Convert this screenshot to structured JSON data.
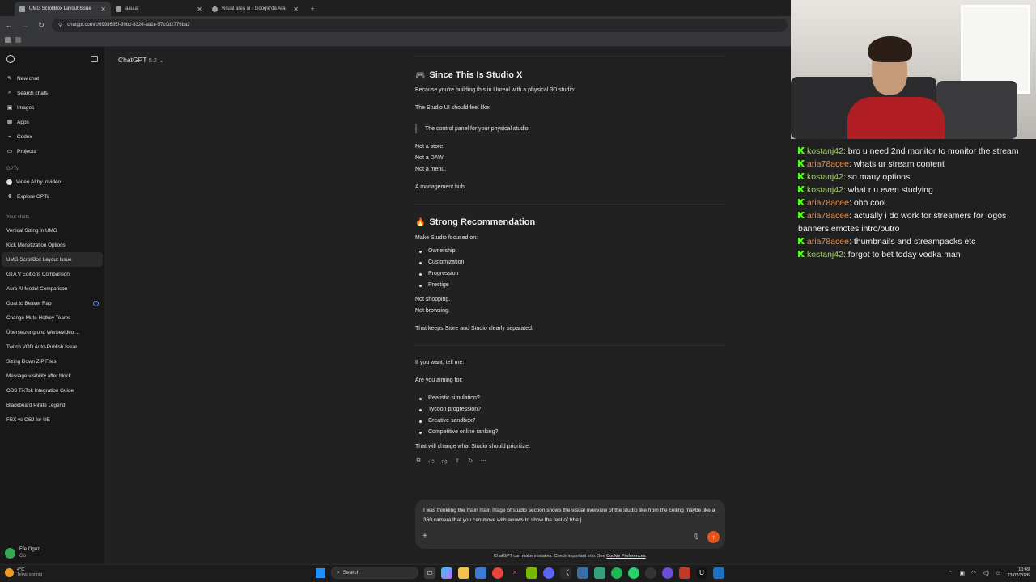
{
  "browser": {
    "tabs": [
      {
        "label": "UMG ScrollBox Layout Issue",
        "active": true
      },
      {
        "label": "aau.at",
        "active": false
      },
      {
        "label": "visual area ui - Google'da Ara",
        "active": false
      }
    ],
    "new_tab": "+",
    "close": "✕",
    "url": "chatgpt.com/c/6993685f-99bc-8326-aa1e-57c0d2776ba2"
  },
  "sidebar": {
    "items": [
      {
        "label": "New chat",
        "icon": "compose-icon"
      },
      {
        "label": "Search chats",
        "icon": "search-icon"
      },
      {
        "label": "Images",
        "icon": "image-icon"
      },
      {
        "label": "Apps",
        "icon": "apps-icon"
      },
      {
        "label": "Codex",
        "icon": "code-icon"
      },
      {
        "label": "Projects",
        "icon": "folder-icon"
      }
    ],
    "gpts_label": "GPTs",
    "gpts": [
      {
        "label": "Video AI by invideo"
      },
      {
        "label": "Explore GPTs"
      }
    ],
    "chats_label": "Your chats",
    "chats": [
      "Vertical Sizing in UMG",
      "Kick Monetization Options",
      "UMG ScrollBox Layout Issue",
      "GTA V Editions Comparison",
      "Aura AI Model Comparison",
      "Goat to Beaver Rap",
      "Change Mute Hotkey Teams",
      "Übersetzung und Werbevideo ...",
      "Twitch VOD Auto-Publish Issue",
      "Sizing Down ZIP Files",
      "Message visibility after block",
      "OBS TikTok Integration Guide",
      "Blackbeard Pirate Legend",
      "FBX vs OBJ for UE"
    ],
    "user": {
      "name": "Efe Oguz",
      "plan": "Go"
    }
  },
  "main": {
    "model": "ChatGPT",
    "model_version": "5.2",
    "section1": {
      "emoji": "🎮",
      "title": "Since This Is Studio X",
      "p1": "Because you're building this in Unreal with a physical 3D studio:",
      "p2": "The Studio UI should feel like:",
      "quote": "The control panel for your physical studio.",
      "not1": "Not a store.",
      "not2": "Not a DAW.",
      "not3": "Not a menu.",
      "hub": "A management hub."
    },
    "section2": {
      "emoji": "🔥",
      "title": "Strong Recommendation",
      "intro": "Make Studio focused on:",
      "bullets": [
        "Ownership",
        "Customization",
        "Progression",
        "Prestige"
      ],
      "not1": "Not shopping.",
      "not2": "Not browsing.",
      "outro": "That keeps Store and Studio clearly separated."
    },
    "section3": {
      "p1": "If you want, tell me:",
      "p2": "Are you aiming for:",
      "bullets": [
        "Realistic simulation?",
        "Tycoon progression?",
        "Creative sandbox?",
        "Competitive online ranking?"
      ],
      "outro": "That will change what Studio should prioritize."
    },
    "composer": {
      "text": "I was thinkiing the main main mage of studio section shows the visual overview of the studio like from the ceiling maybe like a 360 camera that you can move with arrows to show the rest of trhe |"
    },
    "disclaimer": "ChatGPT can make mistakes. Check important info. See",
    "disclaimer_link": "Cookie Preferences",
    "disclaimer_end": "."
  },
  "stream_chat": [
    {
      "user": "kostanj42",
      "color": "green",
      "text": "bro u need 2nd monitor to monitor the stream"
    },
    {
      "user": "aria78acee",
      "color": "orange",
      "text": "whats ur stream content"
    },
    {
      "user": "kostanj42",
      "color": "green",
      "text": "so many options"
    },
    {
      "user": "kostanj42",
      "color": "green",
      "text": "what r u even studying"
    },
    {
      "user": "aria78acee",
      "color": "orange",
      "text": "ohh cool"
    },
    {
      "user": "aria78acee",
      "color": "orange",
      "text": "actually i do work for streamers for logos banners emotes intro/outro"
    },
    {
      "user": "aria78acee",
      "color": "orange",
      "text": "thumbnails and streampacks etc"
    },
    {
      "user": "kostanj42",
      "color": "green",
      "text": "forgot to bet today vodka man"
    }
  ],
  "taskbar": {
    "weather_temp": "4°C",
    "weather_desc": "Teilw. sonnig",
    "search_placeholder": "Search",
    "time": "10:49",
    "date": "23/02/2026"
  },
  "colors": {
    "accent": "#e3541c",
    "kick_green": "#53fc18",
    "user_green": "#9bd65b",
    "user_orange": "#f28c3a"
  }
}
